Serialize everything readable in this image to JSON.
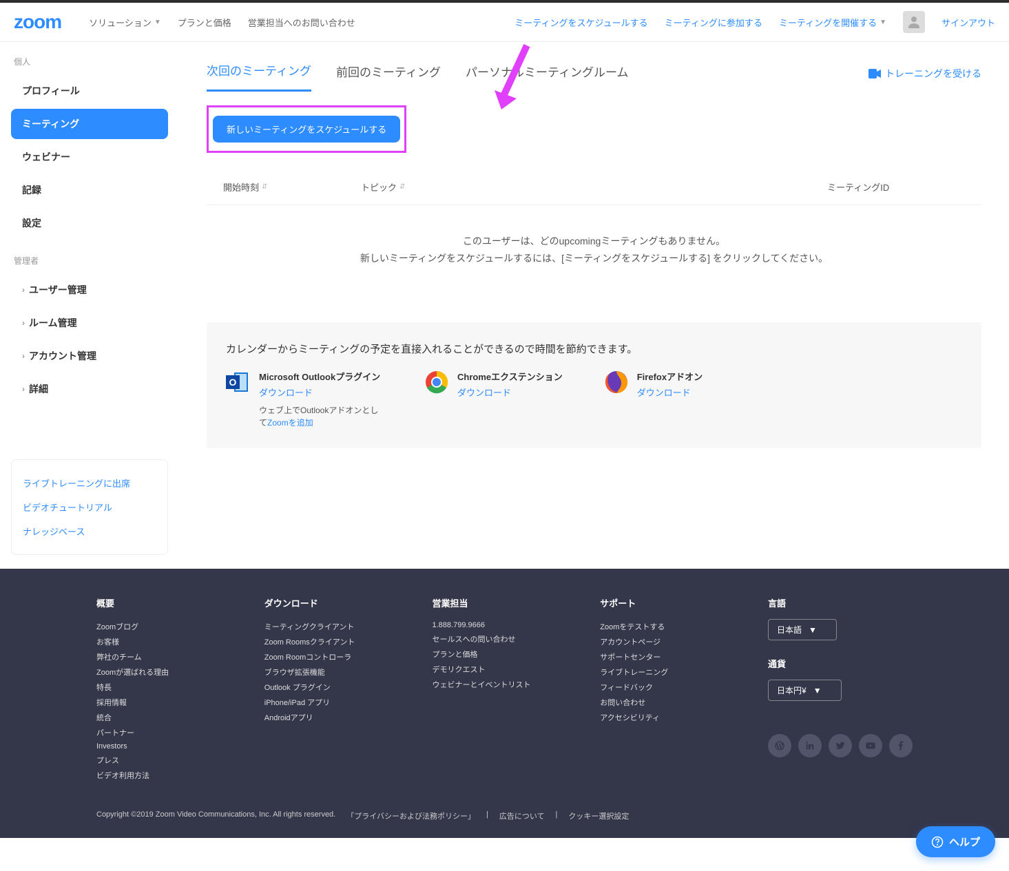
{
  "header": {
    "logo": "zoom",
    "nav_left": [
      {
        "label": "ソリューション",
        "dropdown": true
      },
      {
        "label": "プランと価格",
        "dropdown": false
      },
      {
        "label": "営業担当へのお問い合わせ",
        "dropdown": false
      }
    ],
    "nav_right": [
      {
        "label": "ミーティングをスケジュールする",
        "dropdown": false
      },
      {
        "label": "ミーティングに参加する",
        "dropdown": false
      },
      {
        "label": "ミーティングを開催する",
        "dropdown": true
      }
    ],
    "signout": "サインアウト"
  },
  "sidebar": {
    "personal_label": "個人",
    "personal_items": [
      {
        "label": "プロフィール",
        "active": false
      },
      {
        "label": "ミーティング",
        "active": true
      },
      {
        "label": "ウェビナー",
        "active": false
      },
      {
        "label": "記録",
        "active": false
      },
      {
        "label": "設定",
        "active": false
      }
    ],
    "admin_label": "管理者",
    "admin_items": [
      {
        "label": "ユーザー管理"
      },
      {
        "label": "ルーム管理"
      },
      {
        "label": "アカウント管理"
      },
      {
        "label": "詳細"
      }
    ],
    "help_links": [
      "ライブトレーニングに出席",
      "ビデオチュートリアル",
      "ナレッジベース"
    ]
  },
  "content": {
    "tabs": [
      {
        "label": "次回のミーティング",
        "active": true
      },
      {
        "label": "前回のミーティング",
        "active": false
      },
      {
        "label": "パーソナルミーティングルーム",
        "active": false
      }
    ],
    "training": "トレーニングを受ける",
    "schedule_btn": "新しいミーティングをスケジュールする",
    "table_headers": {
      "start": "開始時刻",
      "topic": "トピック",
      "id": "ミーティングID"
    },
    "empty_line1": "このユーザーは、どのupcomingミーティングもありません。",
    "empty_line2": "新しいミーティングをスケジュールするには、[ミーティングをスケジュールする] をクリックしてください。",
    "integrations": {
      "title": "カレンダーからミーティングの予定を直接入れることができるので時間を節約できます。",
      "items": [
        {
          "name": "Microsoft Outlookプラグイン",
          "download": "ダウンロード",
          "sub_pre": "ウェブ上でOutlookアドオンとして",
          "sub_link": "Zoomを追加"
        },
        {
          "name": "Chromeエクステンション",
          "download": "ダウンロード"
        },
        {
          "name": "Firefoxアドオン",
          "download": "ダウンロード"
        }
      ]
    }
  },
  "footer": {
    "cols": [
      {
        "h": "概要",
        "links": [
          "Zoomブログ",
          "お客様",
          "弊社のチーム",
          "Zoomが選ばれる理由",
          "特長",
          "採用情報",
          "統合",
          "パートナー",
          "Investors",
          "プレス",
          "ビデオ利用方法"
        ]
      },
      {
        "h": "ダウンロード",
        "links": [
          "ミーティングクライアント",
          "Zoom Roomsクライアント",
          "Zoom Roomコントローラ",
          "ブラウザ拡張機能",
          "Outlook プラグイン",
          "iPhone/iPad アプリ",
          "Androidアプリ"
        ]
      },
      {
        "h": "営業担当",
        "links": [
          "1.888.799.9666",
          "セールスへの問い合わせ",
          "プランと価格",
          "デモリクエスト",
          "ウェビナーとイベントリスト"
        ]
      },
      {
        "h": "サポート",
        "links": [
          "Zoomをテストする",
          "アカウントページ",
          "サポートセンター",
          "ライブトレーニング",
          "フィードバック",
          "お問い合わせ",
          "アクセシビリティ"
        ]
      }
    ],
    "lang_h": "言語",
    "lang_val": "日本語",
    "currency_h": "通貨",
    "currency_val": "日本円¥",
    "copyright": "Copyright ©2019 Zoom Video Communications, Inc. All rights reserved.",
    "legal": [
      "「プライバシーおよび法務ポリシー」",
      "広告について",
      "クッキー選択設定"
    ]
  },
  "help_fab": "ヘルプ"
}
